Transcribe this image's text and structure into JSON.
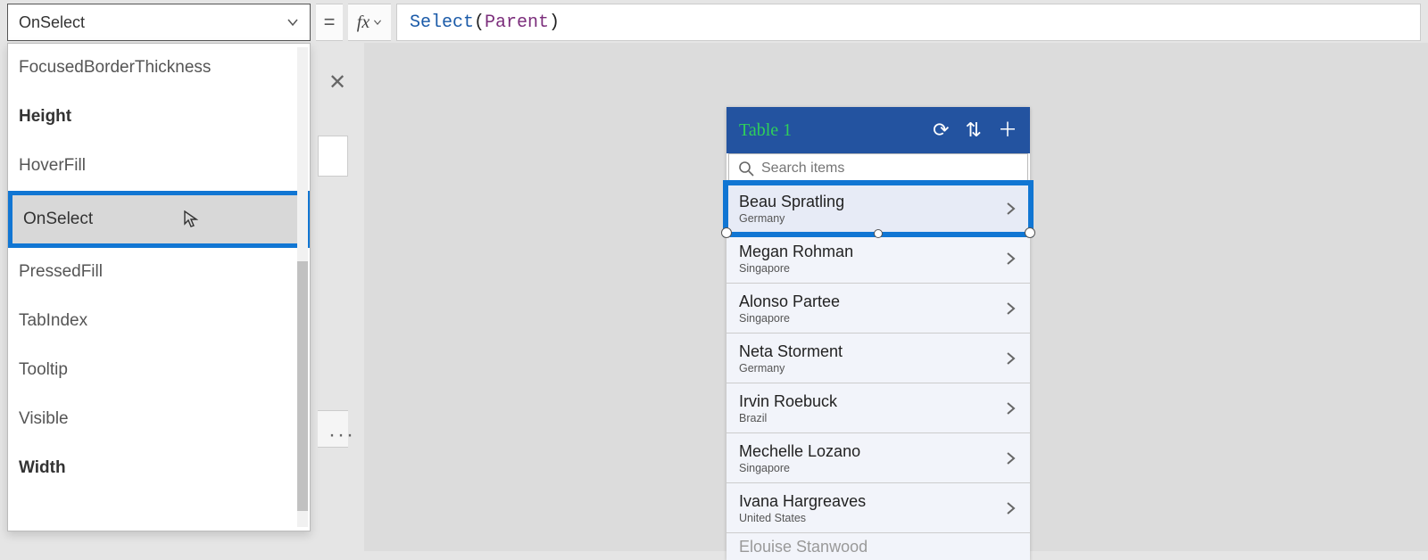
{
  "topbar": {
    "selected_property": "OnSelect",
    "equals": "=",
    "fx_label": "fx",
    "formula_fn": "Select",
    "formula_open": "(",
    "formula_ident": "Parent",
    "formula_close": ")"
  },
  "dropdown": {
    "items": [
      {
        "label": "FocusedBorderThickness",
        "bold": false
      },
      {
        "label": "Height",
        "bold": true
      },
      {
        "label": "HoverFill",
        "bold": false
      },
      {
        "label": "OnSelect",
        "bold": false,
        "selected": true
      },
      {
        "label": "PressedFill",
        "bold": false
      },
      {
        "label": "TabIndex",
        "bold": false
      },
      {
        "label": "Tooltip",
        "bold": false
      },
      {
        "label": "Visible",
        "bold": false
      },
      {
        "label": "Width",
        "bold": true
      }
    ]
  },
  "tree": {
    "close_glyph": "✕",
    "ellipsis": "···"
  },
  "phone": {
    "title": "Table 1",
    "search_placeholder": "Search items",
    "header_icons": {
      "refresh": "⟳",
      "sort": "⇅",
      "add": "＋"
    },
    "rows": [
      {
        "name": "Beau Spratling",
        "sub": "Germany",
        "selected": true
      },
      {
        "name": "Megan Rohman",
        "sub": "Singapore"
      },
      {
        "name": "Alonso Partee",
        "sub": "Singapore"
      },
      {
        "name": "Neta Storment",
        "sub": "Germany"
      },
      {
        "name": "Irvin Roebuck",
        "sub": "Brazil"
      },
      {
        "name": "Mechelle Lozano",
        "sub": "Singapore"
      },
      {
        "name": "Ivana Hargreaves",
        "sub": "United States"
      }
    ],
    "partial_row_name": "Elouise Stanwood"
  }
}
